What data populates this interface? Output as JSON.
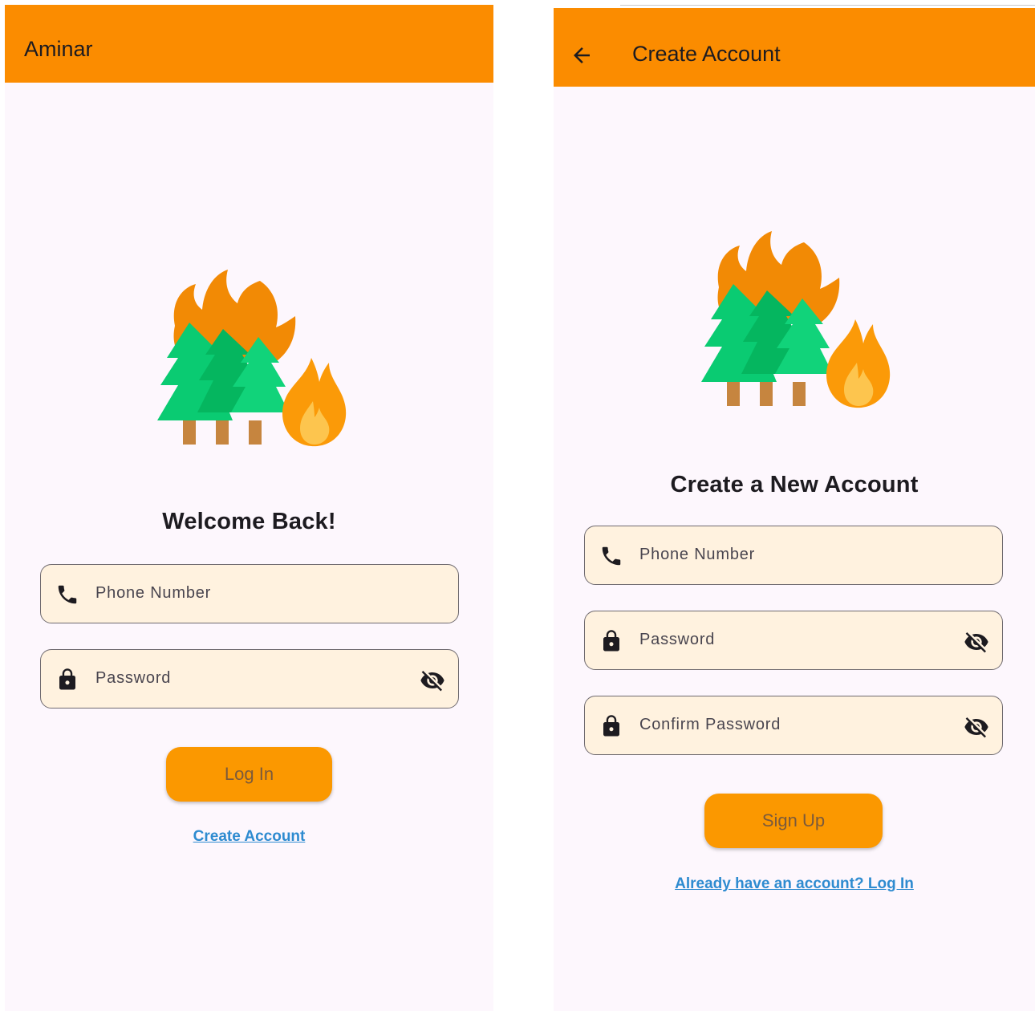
{
  "colors": {
    "primary": "#fb8c00",
    "primary_button": "#fb9800",
    "background": "#fdf7fd",
    "field_fill": "#fff2df",
    "link": "#2e8bd0"
  },
  "login": {
    "appbar_title": "Aminar",
    "heading": "Welcome Back!",
    "phone_placeholder": "Phone Number",
    "password_placeholder": "Password",
    "login_button": "Log In",
    "create_account_link": "Create Account",
    "icons": {
      "phone": "phone-icon",
      "lock": "lock-icon",
      "visibility": "eye-off-icon"
    }
  },
  "signup": {
    "appbar_title": "Create Account",
    "heading": "Create a New Account",
    "phone_placeholder": "Phone Number",
    "password_placeholder": "Password",
    "confirm_password_placeholder": "Confirm Password",
    "signup_button": "Sign Up",
    "login_link": "Already have an account? Log In",
    "icons": {
      "back": "arrow-back-icon",
      "phone": "phone-icon",
      "lock": "lock-icon",
      "visibility": "eye-off-icon"
    }
  }
}
